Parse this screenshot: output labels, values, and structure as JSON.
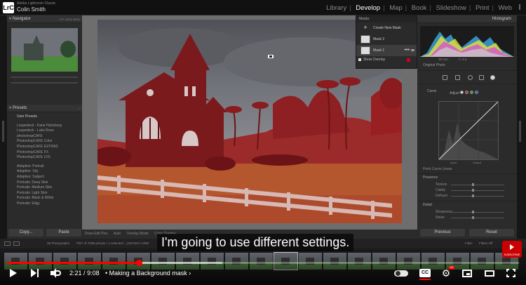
{
  "topbar": {
    "logo": "LrC",
    "app_name": "Adobe Lightroom Classic",
    "user_name": "Colin Smith",
    "modules": [
      "Library",
      "Develop",
      "Map",
      "Book",
      "Slideshow",
      "Print",
      "Web"
    ],
    "active_module": "Develop"
  },
  "left_panel": {
    "navigator_title": "Navigator",
    "navigator_zoom": [
      "FIT",
      "100%",
      "300%"
    ],
    "presets_title": "Presets",
    "preset_groups": [
      {
        "label": "User Presets",
        "items": []
      },
      {
        "label": "",
        "items": [
          "Loupedeck - Kane Hartzberg",
          "Loupedeck - Luke Rose",
          "photoshopCAFE",
          "PhotoshopCAFE Color",
          "PhotoshopCAFE EXTRAS",
          "PhotoshopCAFE FX",
          "PhotoshopCAFE LVS"
        ]
      },
      {
        "label": "",
        "items": [
          "Adaptive: Portrait",
          "Adaptive: Sky",
          "Adaptive: Subject",
          "Portraits: Deep Skin",
          "Portraits: Medium Skin",
          "Portraits: Light Skin",
          "Portraits: Black & White",
          "Portraits: Edgy"
        ]
      }
    ],
    "copy_label": "Copy...",
    "paste_label": "Paste"
  },
  "toolbar": {
    "draw_edit_pins_label": "Draw Edit Pins",
    "draw_edit_pins_value": "Auto",
    "overlay_mode_label": "Overlay Mode",
    "overlay_mode_value": "Color Overlay"
  },
  "masks_panel": {
    "title": "Masks",
    "create_label": "Create New Mask",
    "masks": [
      {
        "name": "Mask 2",
        "selected": false
      },
      {
        "name": "Mask 1",
        "selected": true
      }
    ],
    "more_label": "•••",
    "show_overlay_label": "Show Overlay",
    "overlay_color": "#d0021b"
  },
  "right_panel": {
    "histogram_title": "Histogram",
    "histogram_meta": [
      "",
      "28 mm",
      "f / 4.0",
      ""
    ],
    "original_photo_label": "Original Photo",
    "curve_title": "Curve",
    "curve_adjust_label": "Adjust",
    "curve_point_label": "Point Curve",
    "curve_point_value": "Linear",
    "curve_input_label": "Input",
    "curve_output_label": "Output",
    "presence_title": "Presence",
    "presence_sliders": [
      "Texture",
      "Clarity",
      "Dehaze"
    ],
    "detail_title": "Detail",
    "detail_sliders": [
      "Sharpness",
      "Noise"
    ],
    "previous_label": "Previous",
    "reset_label": "Reset"
  },
  "filmstrip_bar": {
    "pages": [
      "1",
      "2"
    ],
    "count": "86 Photographs",
    "selection": "7/8/7 of 75/86 photos / 1 selected / _DSC5217.ARW",
    "filter_label": "Filter:",
    "filter_value": "Filters Off"
  },
  "youtube": {
    "caption": "I'm going to use different settings.",
    "current_time": "2:21",
    "duration": "9:08",
    "chapter": "Making a Background mask",
    "progress_fraction": 0.257,
    "buffered_fraction": 0.42,
    "cc_label": "CC",
    "hd_badge": "HD",
    "subscribe_label": "SUBSCRIBE",
    "brand_color": "#ff0000"
  }
}
